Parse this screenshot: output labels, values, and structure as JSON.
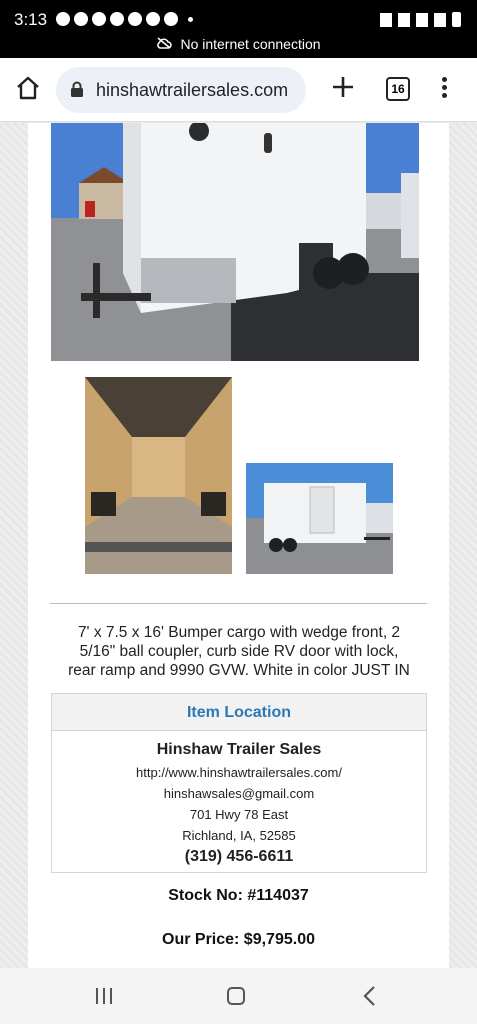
{
  "status_bar": {
    "time": "3:13",
    "network_status": "No internet connection"
  },
  "browser": {
    "url": "hinshawtrailersales.com",
    "tab_count": "16"
  },
  "listing": {
    "description": "7' x 7.5 x 16' Bumper cargo with wedge front, 2 5/16\" ball coupler, curb side RV door with lock, rear ramp and 9990 GVW. White in color JUST IN",
    "location": {
      "heading": "Item Location",
      "name": "Hinshaw Trailer Sales",
      "website": "http://www.hinshawtrailersales.com/",
      "email": "hinshawsales@gmail.com",
      "address": "701 Hwy 78 East",
      "city_state_zip": "Richland, IA, 52585",
      "phone": "(319) 456-6611"
    },
    "stock_no": "Stock No: #114037",
    "price": "Our Price: $9,795.00"
  },
  "colors": {
    "link_heading": "#2a78b5",
    "status_bar_bg": "#000000"
  }
}
